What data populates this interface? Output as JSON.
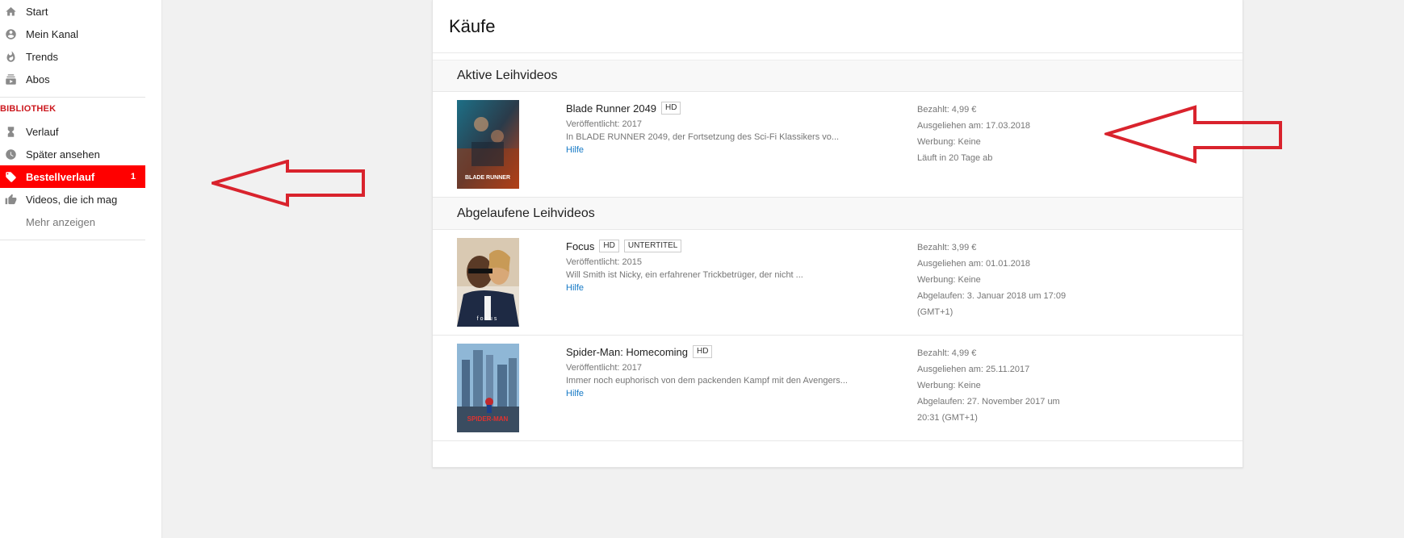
{
  "sidebar": {
    "items": [
      {
        "label": "Start",
        "icon": "home-icon"
      },
      {
        "label": "Mein Kanal",
        "icon": "account-icon"
      },
      {
        "label": "Trends",
        "icon": "flame-icon"
      },
      {
        "label": "Abos",
        "icon": "subscriptions-icon"
      }
    ],
    "library_label": "BIBLIOTHEK",
    "library": [
      {
        "label": "Verlauf",
        "icon": "hourglass-icon"
      },
      {
        "label": "Später ansehen",
        "icon": "clock-icon"
      },
      {
        "label": "Bestellverlauf",
        "icon": "tag-icon",
        "count": "1"
      },
      {
        "label": "Videos, die ich mag",
        "icon": "thumb-up-icon"
      }
    ],
    "more_label": "Mehr anzeigen"
  },
  "main": {
    "title": "Käufe",
    "active_heading": "Aktive Leihvideos",
    "expired_heading": "Abgelaufene Leihvideos",
    "active": [
      {
        "title": "Blade Runner 2049",
        "badges": [
          "HD"
        ],
        "released": "Veröffentlicht: 2017",
        "desc": "In BLADE RUNNER 2049, der Fortsetzung des Sci-Fi Klassikers vo...",
        "help": "Hilfe",
        "paid": "Bezahlt: 4,99 €",
        "rented": "Ausgeliehen am: 17.03.2018",
        "ads": "Werbung: Keine",
        "status": "Läuft in 20 Tage ab",
        "poster_text": "BLADE RUNNER"
      }
    ],
    "expired": [
      {
        "title": "Focus",
        "badges": [
          "HD",
          "UNTERTITEL"
        ],
        "released": "Veröffentlicht: 2015",
        "desc": "Will Smith ist Nicky, ein erfahrener Trickbetrüger, der nicht ...",
        "help": "Hilfe",
        "paid": "Bezahlt: 3,99 €",
        "rented": "Ausgeliehen am: 01.01.2018",
        "ads": "Werbung: Keine",
        "status": "Abgelaufen: 3. Januar 2018 um 17:09",
        "status2": "(GMT+1)",
        "poster_text": "focus"
      },
      {
        "title": "Spider-Man: Homecoming",
        "badges": [
          "HD"
        ],
        "released": "Veröffentlicht: 2017",
        "desc": "Immer noch euphorisch von dem packenden Kampf mit den Avengers...",
        "help": "Hilfe",
        "paid": "Bezahlt: 4,99 €",
        "rented": "Ausgeliehen am: 25.11.2017",
        "ads": "Werbung: Keine",
        "status": "Abgelaufen: 27. November 2017 um",
        "status2": "20:31 (GMT+1)",
        "poster_text": "SPIDER-MAN"
      }
    ]
  },
  "colors": {
    "accent": "#ff0000",
    "link": "#167ac6",
    "arrow": "#d9232d"
  }
}
